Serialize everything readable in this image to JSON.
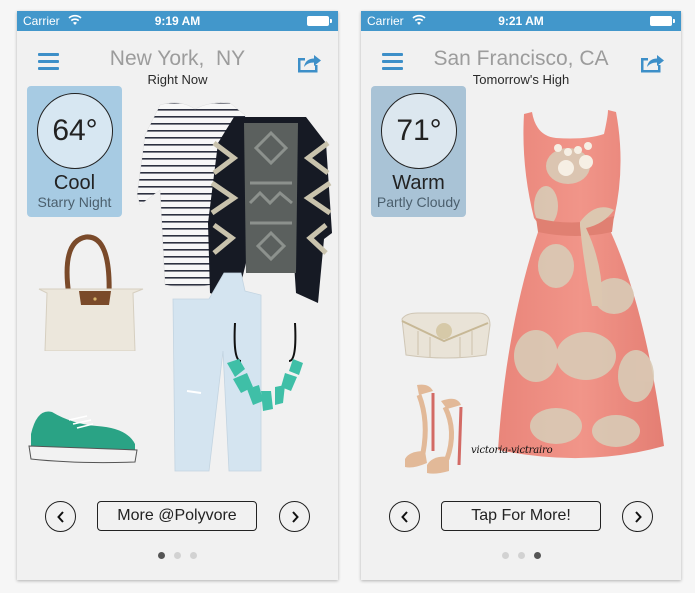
{
  "screens": [
    {
      "status_bar": {
        "carrier": "Carrier",
        "time": "9:19 AM"
      },
      "header": {
        "location": "New York,  NY",
        "timeframe": "Right Now"
      },
      "weather": {
        "temperature": "64°",
        "feel": "Cool",
        "condition": "Starry Night"
      },
      "outfit_items": [
        "striped-tee",
        "geometric-cardigan",
        "tote-bag",
        "light-wash-jeans",
        "turquoise-necklace",
        "green-sneakers"
      ],
      "more_button_label": "More @Polyvore",
      "page_indicator": {
        "total": 3,
        "current": 1
      }
    },
    {
      "status_bar": {
        "carrier": "Carrier",
        "time": "9:21 AM"
      },
      "header": {
        "location": "San Francisco, CA",
        "timeframe": "Tomorrow's High"
      },
      "weather": {
        "temperature": "71°",
        "feel": "Warm",
        "condition": "Partly Cloudy"
      },
      "outfit_items": [
        "floral-coral-dress",
        "beaded-clutch",
        "nude-sandals"
      ],
      "watermark": "victoria-victrairo",
      "more_button_label": "Tap For More!",
      "page_indicator": {
        "total": 3,
        "current": 3
      }
    }
  ],
  "colors": {
    "status_bar": "#4297cb",
    "accent_icon": "#3d8fc8",
    "card_cool": "#a7cbe3",
    "card_warm": "#a9c3d6"
  }
}
